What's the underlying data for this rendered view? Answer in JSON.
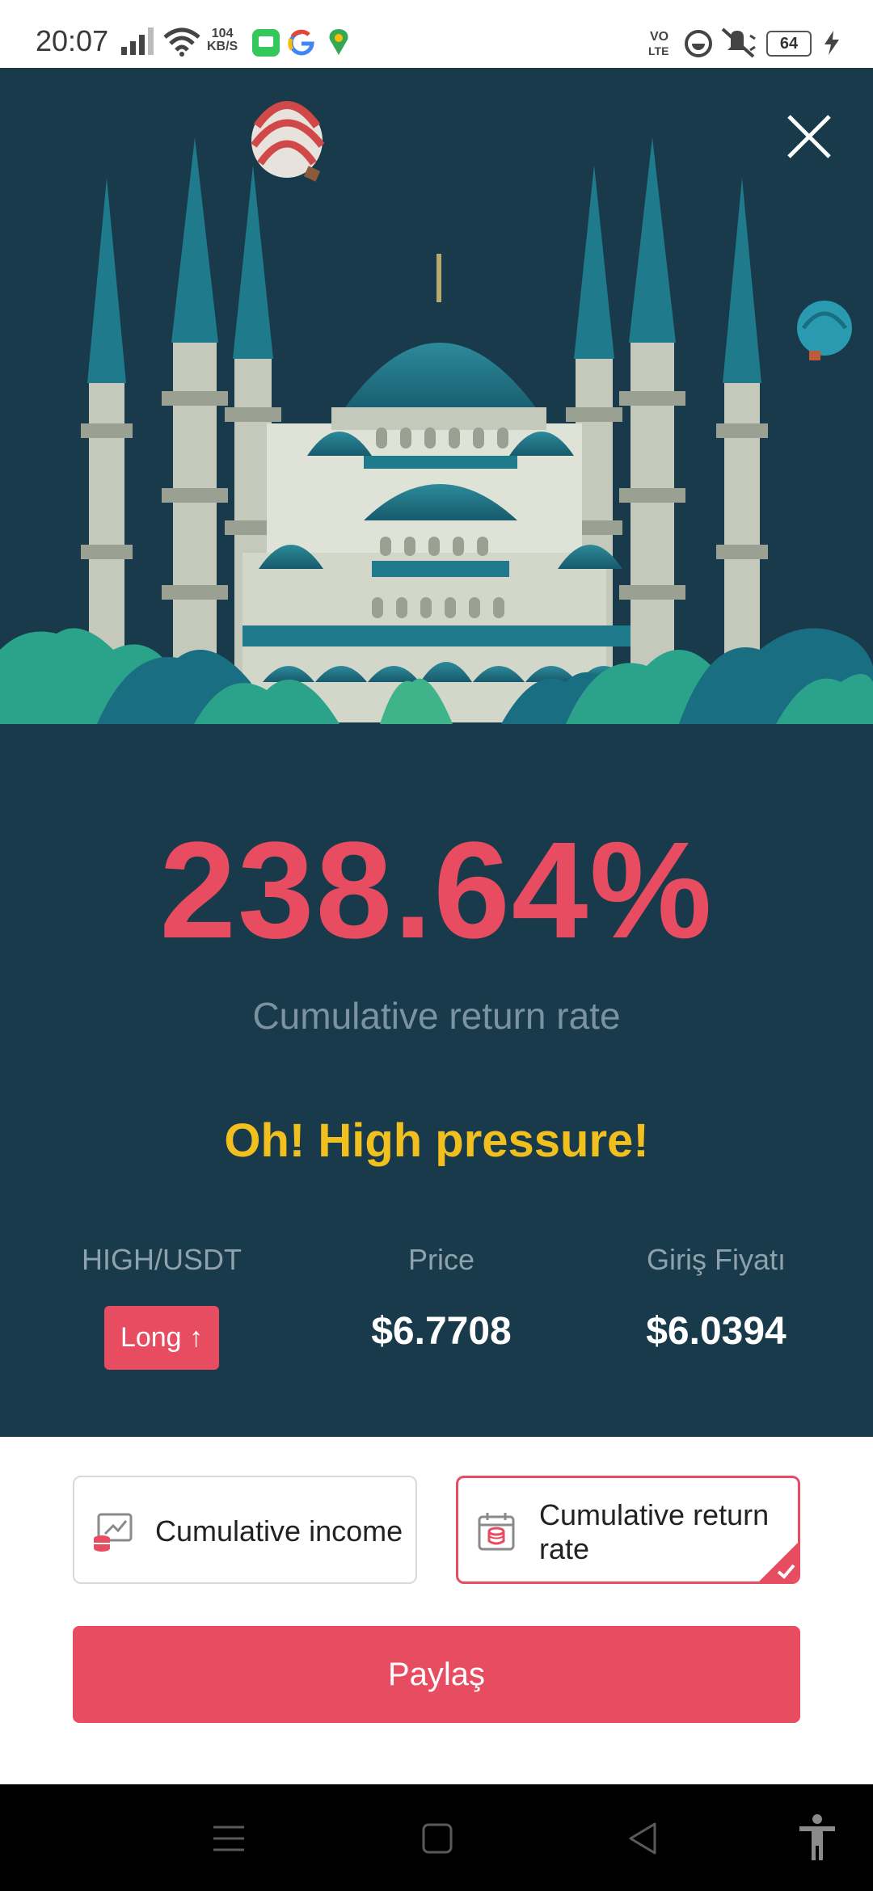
{
  "status_bar": {
    "time": "20:07",
    "network_speed_value": "104",
    "network_speed_unit": "KB/S",
    "battery": "64",
    "icons": [
      "signal-icon",
      "wifi-icon",
      "messages-app-icon",
      "google-icon",
      "maps-icon",
      "volte-icon",
      "focus-icon",
      "mute-icon",
      "battery-icon",
      "charging-icon"
    ]
  },
  "card": {
    "return_value": "238.64%",
    "return_caption": "Cumulative return rate",
    "slogan": "Oh! High pressure!",
    "pair_label": "HIGH/USDT",
    "position_badge": "Long ↑",
    "price_label": "Price",
    "price_value": "$6.7708",
    "entry_label": "Giriş Fiyatı",
    "entry_value": "$6.0394"
  },
  "options": [
    {
      "label": "Cumulative income",
      "icon": "income-chart-icon",
      "selected": false
    },
    {
      "label": "Cumulative return rate",
      "icon": "calendar-coins-icon",
      "selected": true
    }
  ],
  "share_button": "Paylaş",
  "nav_bar": {
    "buttons": [
      "menu",
      "home",
      "back",
      "accessibility"
    ]
  },
  "colors": {
    "card_bg": "#183a4a",
    "accent_red": "#e84c60",
    "slogan_yellow": "#f2c01e",
    "muted_text": "#8ea2ad"
  }
}
